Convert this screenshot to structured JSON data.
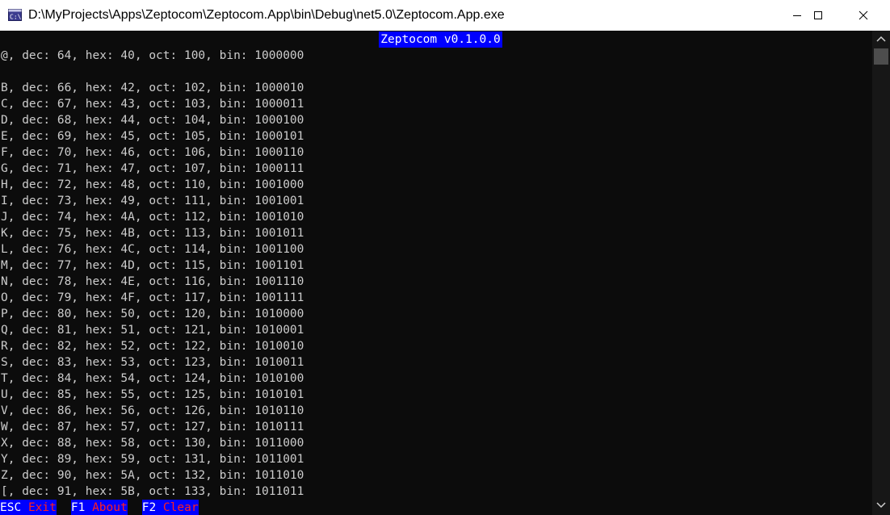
{
  "window": {
    "title": "D:\\MyProjects\\Apps\\Zeptocom\\Zeptocom.App\\bin\\Debug\\net5.0\\Zeptocom.App.exe",
    "icon": "console-app-icon"
  },
  "banner": {
    "text": "Zeptocom v0.1.0.0",
    "background": "#0000ff"
  },
  "console": {
    "lines": [
      "@, dec: 64, hex: 40, oct: 100, bin: 1000000",
      "",
      "B, dec: 66, hex: 42, oct: 102, bin: 1000010",
      "C, dec: 67, hex: 43, oct: 103, bin: 1000011",
      "D, dec: 68, hex: 44, oct: 104, bin: 1000100",
      "E, dec: 69, hex: 45, oct: 105, bin: 1000101",
      "F, dec: 70, hex: 46, oct: 106, bin: 1000110",
      "G, dec: 71, hex: 47, oct: 107, bin: 1000111",
      "H, dec: 72, hex: 48, oct: 110, bin: 1001000",
      "I, dec: 73, hex: 49, oct: 111, bin: 1001001",
      "J, dec: 74, hex: 4A, oct: 112, bin: 1001010",
      "K, dec: 75, hex: 4B, oct: 113, bin: 1001011",
      "L, dec: 76, hex: 4C, oct: 114, bin: 1001100",
      "M, dec: 77, hex: 4D, oct: 115, bin: 1001101",
      "N, dec: 78, hex: 4E, oct: 116, bin: 1001110",
      "O, dec: 79, hex: 4F, oct: 117, bin: 1001111",
      "P, dec: 80, hex: 50, oct: 120, bin: 1010000",
      "Q, dec: 81, hex: 51, oct: 121, bin: 1010001",
      "R, dec: 82, hex: 52, oct: 122, bin: 1010010",
      "S, dec: 83, hex: 53, oct: 123, bin: 1010011",
      "T, dec: 84, hex: 54, oct: 124, bin: 1010100",
      "U, dec: 85, hex: 55, oct: 125, bin: 1010101",
      "V, dec: 86, hex: 56, oct: 126, bin: 1010110",
      "W, dec: 87, hex: 57, oct: 127, bin: 1010111",
      "X, dec: 88, hex: 58, oct: 130, bin: 1011000",
      "Y, dec: 89, hex: 59, oct: 131, bin: 1011001",
      "Z, dec: 90, hex: 5A, oct: 132, bin: 1011010",
      "[, dec: 91, hex: 5B, oct: 133, bin: 1011011"
    ]
  },
  "function_keys": [
    {
      "key": "ESC",
      "label": "Exit"
    },
    {
      "key": "F1",
      "label": "About"
    },
    {
      "key": "F2",
      "label": "Clear"
    }
  ],
  "colors": {
    "console_bg": "#0c0c0c",
    "console_text": "#cccccc",
    "fkey_bg": "#0000ff",
    "fkey_key": "#ffffff",
    "fkey_label": "#ff2020"
  }
}
